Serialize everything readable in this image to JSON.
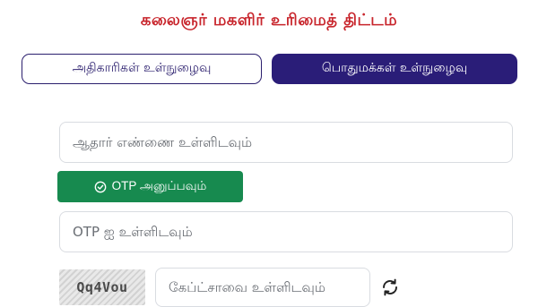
{
  "header": {
    "title": "கலைஞர் மகளிர் உரிமைத் திட்டம்"
  },
  "tabs": {
    "officials_label": "அதிகாரிகள் உள்நுழைவு",
    "public_label": "பொதுமக்கள் உள்நுழைவு",
    "active": "public"
  },
  "form": {
    "aadhaar_placeholder": "ஆதார் எண்ணை உள்ளிடவும்",
    "send_otp_label": "OTP அனுப்பவும்",
    "otp_placeholder": "OTP ஐ உள்ளிடவும்",
    "captcha_text": "Qq4Vou",
    "captcha_placeholder": "கேப்ட்சாவை உள்ளிடவும்"
  },
  "icons": {
    "send_otp": "check-circle-icon",
    "refresh": "refresh-icon"
  },
  "colors": {
    "title": "#c8252c",
    "primary": "#2a1d78",
    "success": "#178a4f"
  }
}
